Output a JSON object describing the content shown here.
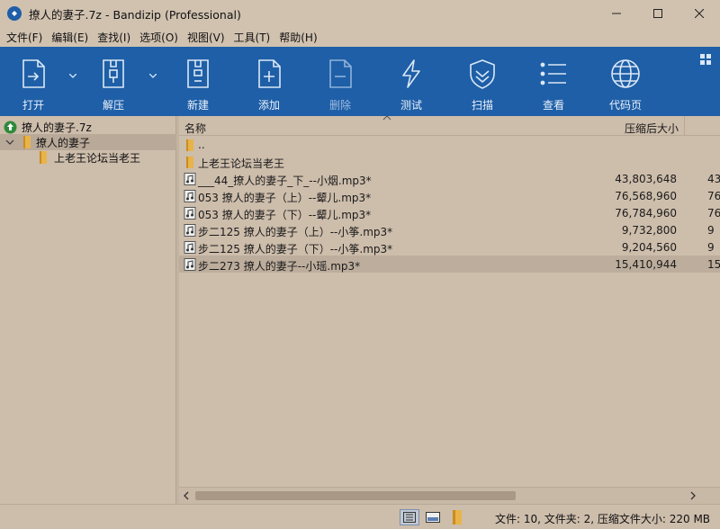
{
  "window": {
    "title": "撩人的妻子.7z - Bandizip (Professional)"
  },
  "menu": [
    "文件(F)",
    "编辑(E)",
    "查找(I)",
    "选项(O)",
    "视图(V)",
    "工具(T)",
    "帮助(H)"
  ],
  "toolbar": {
    "open": "打开",
    "extract": "解压",
    "new": "新建",
    "add": "添加",
    "delete": "删除",
    "test": "测试",
    "scan": "扫描",
    "view": "查看",
    "codepage": "代码页"
  },
  "tree": {
    "root": "撩人的妻子.7z",
    "child": "撩人的妻子",
    "grandchild": "上老王论坛当老王"
  },
  "columns": {
    "name": "名称",
    "compressed_size": "压缩后大小"
  },
  "files": [
    {
      "name": "..",
      "size": "",
      "size2": ""
    },
    {
      "name": "上老王论坛当老王",
      "size": "",
      "size2": ""
    },
    {
      "name": "___44_撩人的妻子_下_--小烟.mp3*",
      "size": "43,803,648",
      "size2": "43"
    },
    {
      "name": "053 撩人的妻子（上）--颦儿.mp3*",
      "size": "76,568,960",
      "size2": "76"
    },
    {
      "name": "053 撩人的妻子（下）--颦儿.mp3*",
      "size": "76,784,960",
      "size2": "76"
    },
    {
      "name": "步二125 撩人的妻子（上）--小筝.mp3*",
      "size": "9,732,800",
      "size2": "9"
    },
    {
      "name": "步二125 撩人的妻子（下）--小筝.mp3*",
      "size": "9,204,560",
      "size2": "9"
    },
    {
      "name": "步二273 撩人的妻子--小瑶.mp3*",
      "size": "15,410,944",
      "size2": "15"
    }
  ],
  "status": {
    "text": "文件: 10, 文件夹: 2, 压缩文件大小: 220 MB"
  },
  "colors": {
    "toolbar_bg": "#1e5fa7",
    "window_bg": "#cbbba9"
  }
}
